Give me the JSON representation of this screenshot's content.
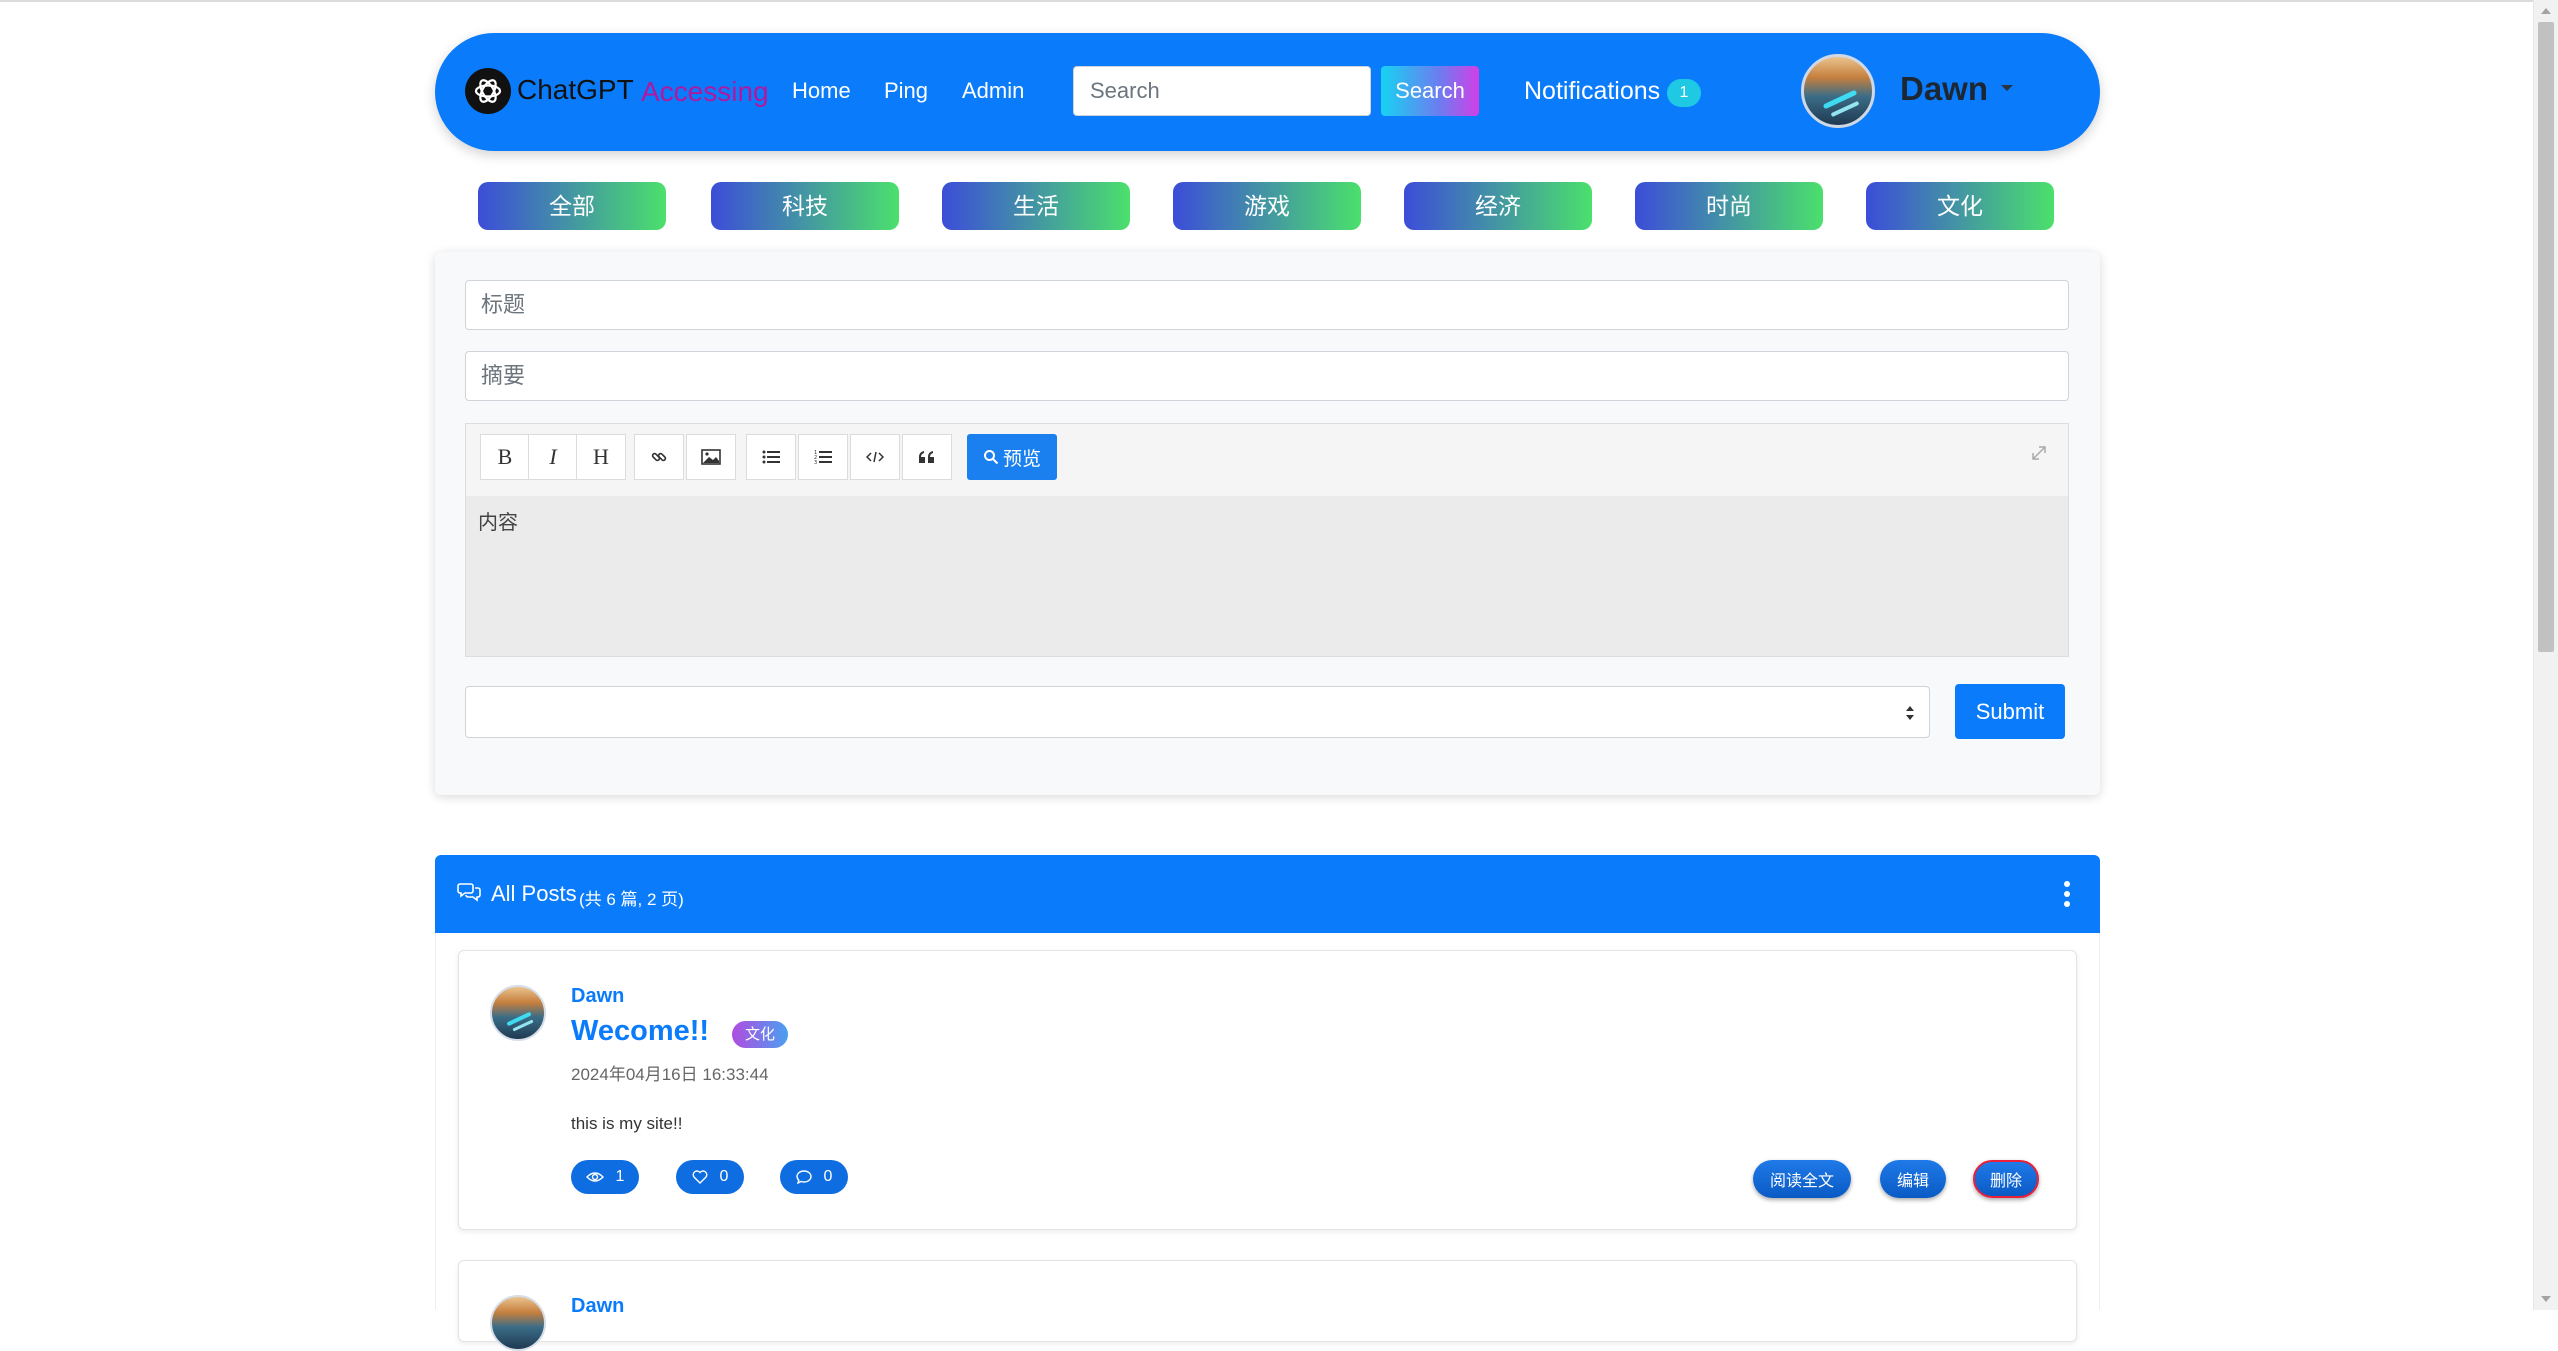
{
  "navbar": {
    "brand": "ChatGPT",
    "brand_status": "Accessing",
    "links": [
      "Home",
      "Ping",
      "Admin"
    ],
    "search_placeholder": "Search",
    "search_button": "Search",
    "notifications_label": "Notifications",
    "notifications_count": "1",
    "user_name": "Dawn"
  },
  "categories": [
    "全部",
    "科技",
    "生活",
    "游戏",
    "经济",
    "时尚",
    "文化"
  ],
  "editor": {
    "title_placeholder": "标题",
    "summary_placeholder": "摘要",
    "content_placeholder": "内容",
    "toolbar": {
      "bold": "B",
      "italic": "I",
      "heading": "H",
      "preview": "预览"
    },
    "category_select_value": "",
    "submit_label": "Submit"
  },
  "posts": {
    "header_title": "All Posts",
    "header_count": "(共 6 篇, 2 页)",
    "items": [
      {
        "author": "Dawn",
        "title": "Wecome!!",
        "tag": "文化",
        "date": "2024年04月16日 16:33:44",
        "excerpt": "this is my site!!",
        "views": "1",
        "likes": "0",
        "comments": "0",
        "read_label": "阅读全文",
        "edit_label": "编辑",
        "delete_label": "删除"
      },
      {
        "author": "Dawn"
      }
    ]
  },
  "colors": {
    "primary": "#0a7cfb",
    "brand_status": "#b0189e",
    "danger_border": "#e8203a"
  }
}
